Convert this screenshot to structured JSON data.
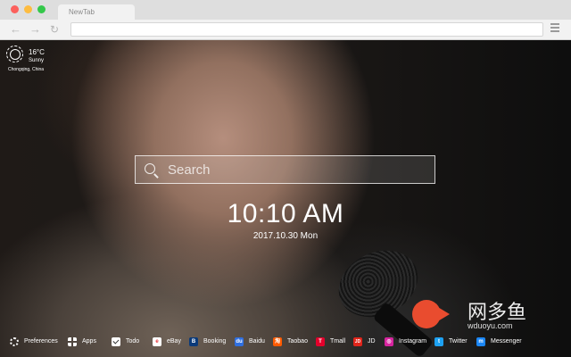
{
  "browser": {
    "tab_title": "NewTab",
    "nav": {
      "back_glyph": "←",
      "forward_glyph": "→",
      "reload_glyph": "↻"
    },
    "address_value": ""
  },
  "weather": {
    "temperature": "16°C",
    "condition": "Sunny",
    "location": "Chongqing,  China",
    "icon": "sun-icon"
  },
  "search": {
    "placeholder": "Search",
    "value": ""
  },
  "clock": {
    "time": "10:10 AM",
    "date": "2017.10.30 Mon"
  },
  "watermark": {
    "text_cn": "网多鱼",
    "url": "wduoyu.com"
  },
  "bottom_bar": {
    "items": [
      {
        "label": "Preferences",
        "icon": "gear-icon"
      },
      {
        "label": "Apps",
        "icon": "grid-icon"
      },
      {
        "label": "Todo",
        "icon": "check-icon"
      },
      {
        "label": "eBay",
        "icon": "ebay-icon",
        "color": "#ffffff",
        "glyph": "e"
      },
      {
        "label": "Booking",
        "icon": "booking-icon",
        "color": "#0a3a7a",
        "glyph": "B"
      },
      {
        "label": "Baidu",
        "icon": "baidu-icon",
        "color": "#2f6fe0",
        "glyph": "du"
      },
      {
        "label": "Taobao",
        "icon": "taobao-icon",
        "color": "#ff5a00",
        "glyph": "淘"
      },
      {
        "label": "Tmall",
        "icon": "tmall-icon",
        "color": "#e4002b",
        "glyph": "T"
      },
      {
        "label": "JD",
        "icon": "jd-icon",
        "color": "#e1251b",
        "glyph": "JD"
      },
      {
        "label": "Instagram",
        "icon": "instagram-icon",
        "color": "#d6249f",
        "glyph": "◎"
      },
      {
        "label": "Twitter",
        "icon": "twitter-icon",
        "color": "#1da1f2",
        "glyph": "t"
      },
      {
        "label": "Messenger",
        "icon": "messenger-icon",
        "color": "#1b86f5",
        "glyph": "m"
      }
    ]
  }
}
